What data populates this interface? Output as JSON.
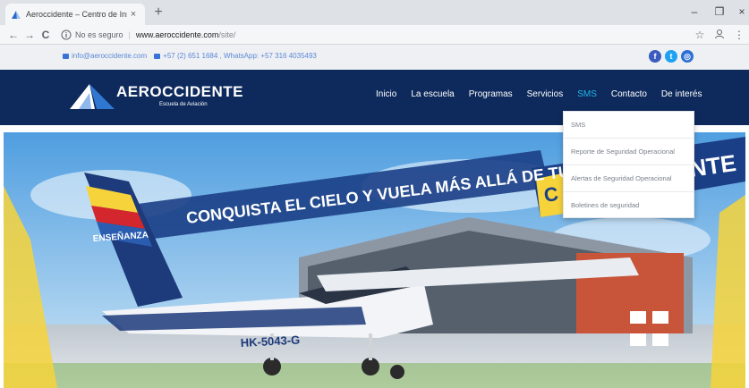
{
  "browser": {
    "tab_title": "Aeroccidente – Centro de Instru",
    "tab_close": "×",
    "new_tab": "+",
    "win_min": "–",
    "win_max": "❐",
    "win_close": "×",
    "back": "←",
    "forward": "→",
    "reload": "C",
    "not_secure": "No es seguro",
    "url_host": "www.aeroccidente.com",
    "url_path": "/site/",
    "bookmark": "☆"
  },
  "topbar": {
    "email": "info@aeroccidente.com",
    "phone": "+57 (2) 651 1684 , WhatsApp: +57 316 4035493",
    "social": [
      {
        "icon": "facebook-icon",
        "glyph": "f",
        "color": "#3b5bbf"
      },
      {
        "icon": "twitter-icon",
        "glyph": "t",
        "color": "#1da1f2"
      },
      {
        "icon": "instagram-icon",
        "glyph": "◎",
        "color": "#2c6fd6"
      }
    ]
  },
  "header": {
    "logo_text": "AEROCCIDENTE",
    "logo_sub": "Escuela de Aviación",
    "menu": [
      {
        "label": "Inicio",
        "active": false
      },
      {
        "label": "La escuela",
        "active": false
      },
      {
        "label": "Programas",
        "active": false
      },
      {
        "label": "Servicios",
        "active": false
      },
      {
        "label": "SMS",
        "active": true
      },
      {
        "label": "Contacto",
        "active": false
      },
      {
        "label": "De interés",
        "active": false
      }
    ]
  },
  "dropdown": {
    "items": [
      "SMS",
      "Reporte de Seguridad Operacional",
      "Alertas de Seguridad Operacional",
      "Boletines de seguridad"
    ]
  },
  "hero": {
    "slogan": "CONQUISTA EL CIELO Y VUELA MÁS ALLÁ DE TUS LÍMITES",
    "side_banner": "NTE",
    "side_banner_left": "C",
    "tail_text": "ENSEÑANZA",
    "plane_reg": "HK-5043-G",
    "colors": {
      "sky": "#6fb4e4",
      "banner": "#1b3f86",
      "yellow": "#f6d33a",
      "hangar": "#c8553a"
    }
  }
}
